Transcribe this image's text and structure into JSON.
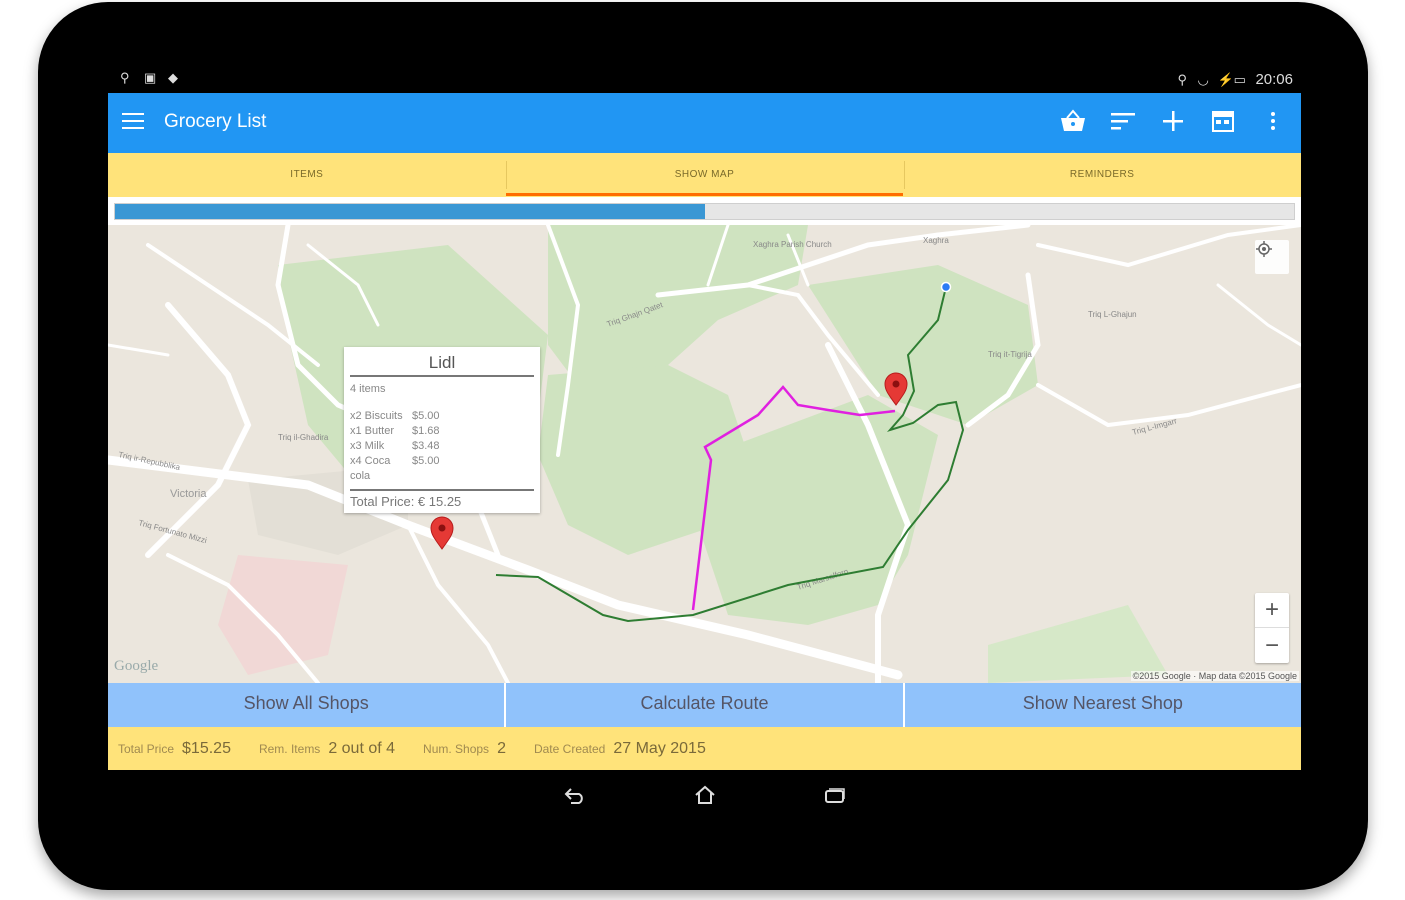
{
  "status_bar": {
    "time": "20:06"
  },
  "app_bar": {
    "title": "Grocery List",
    "icons": [
      "menu-icon",
      "basket-icon",
      "sort-icon",
      "add-icon",
      "calendar-icon",
      "more-vert-icon"
    ]
  },
  "tabs": [
    {
      "label": "ITEMS",
      "active": false
    },
    {
      "label": "SHOW MAP",
      "active": true
    },
    {
      "label": "REMINDERS",
      "active": false
    }
  ],
  "progress": {
    "fraction": 0.5
  },
  "map": {
    "labels": [
      "Xaghra Parish Church",
      "Xaghra",
      "Victoria",
      "Triq ir-Repubblika",
      "Triq Ghajn Qatet",
      "Triq L-Ghajun",
      "Triq it-Tigrija",
      "Triq il-Ghadira",
      "Triq Marsalforn",
      "Triq L-Imgarr",
      "Triq Fortunato Mizzi"
    ],
    "popup": {
      "title": "Lidl",
      "count": "4 items",
      "items": [
        {
          "name": "x2 Biscuits",
          "price": "$5.00"
        },
        {
          "name": "x1 Butter",
          "price": "$1.68"
        },
        {
          "name": "x3 Milk",
          "price": "$3.48"
        },
        {
          "name": "x4 Coca cola",
          "price": "$5.00"
        }
      ],
      "total": "Total Price: € 15.25"
    },
    "google_logo": "Google",
    "attribution": "©2015 Google · Map data ©2015 Google",
    "zoom_in": "+",
    "zoom_out": "−",
    "colors": {
      "route_magenta": "#e020e0",
      "route_green": "#2e7d32",
      "marker": "#e53935",
      "my_location": "#2a7bf5"
    }
  },
  "buttons": {
    "show_all": "Show All Shops",
    "calculate": "Calculate Route",
    "nearest": "Show Nearest Shop"
  },
  "footer": {
    "total_price_label": "Total Price",
    "total_price": "$15.25",
    "rem_items_label": "Rem. Items",
    "rem_items": "2 out of 4",
    "num_shops_label": "Num. Shops",
    "num_shops": "2",
    "date_created_label": "Date Created",
    "date_created": "27 May 2015"
  },
  "nav_bar": {
    "icons": [
      "back-icon",
      "home-icon",
      "recents-icon"
    ]
  },
  "theme": {
    "primary": "#2196f3",
    "tab_bg": "#ffe37a",
    "tab_indicator": "#ff6d00",
    "button_bg": "#90c2fb",
    "progress": "#3a97d4"
  }
}
